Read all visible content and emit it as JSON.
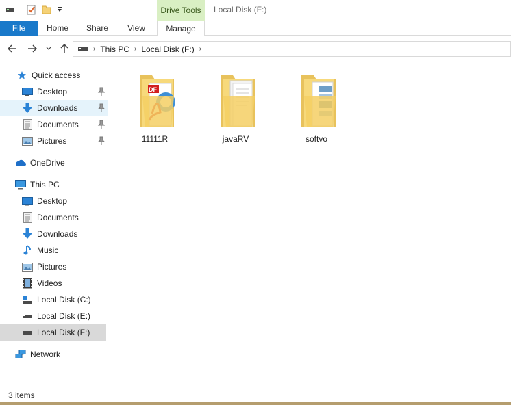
{
  "ribbon": {
    "context_group": "Drive Tools",
    "window_title": "Local Disk (F:)",
    "tabs": [
      "File",
      "Home",
      "Share",
      "View",
      "Manage"
    ]
  },
  "address": {
    "crumbs": [
      "This PC",
      "Local Disk (F:)"
    ]
  },
  "nav": {
    "quick_access": "Quick access",
    "quick_items": [
      "Desktop",
      "Downloads",
      "Documents",
      "Pictures"
    ],
    "onedrive": "OneDrive",
    "this_pc": "This PC",
    "pc_items": [
      "Desktop",
      "Documents",
      "Downloads",
      "Music",
      "Pictures",
      "Videos",
      "Local Disk (C:)",
      "Local Disk (E:)",
      "Local Disk (F:)"
    ],
    "network": "Network"
  },
  "folders": [
    {
      "name": "11111R",
      "icon": "pdf-folder-icon"
    },
    {
      "name": "javaRV",
      "icon": "document-folder-icon"
    },
    {
      "name": "softvo",
      "icon": "image-folder-icon"
    }
  ],
  "status": {
    "items": "3 items"
  },
  "colors": {
    "file_tab": "#1979ca",
    "context_tab": "#d9efc3",
    "selected_quick": "#e5f3fb",
    "selected_drive": "#d9d9d9"
  }
}
